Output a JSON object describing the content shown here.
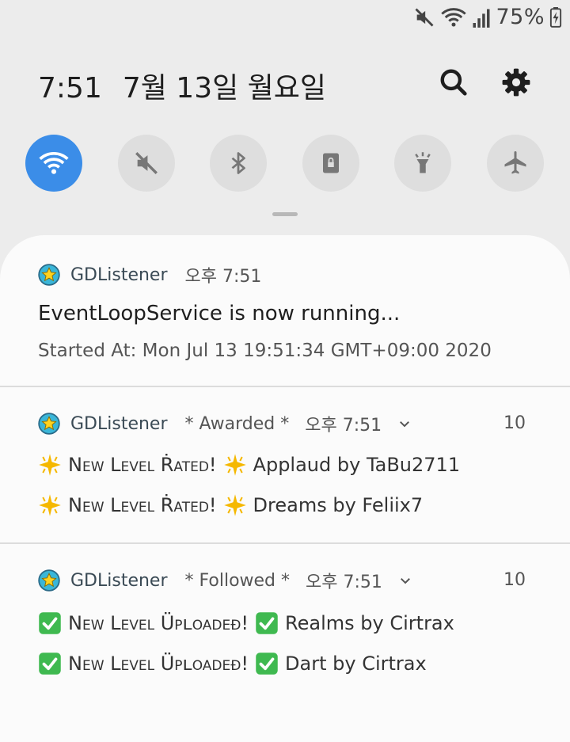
{
  "status": {
    "battery": "75%"
  },
  "header": {
    "time": "7:51",
    "date": "7월 13일 월요일"
  },
  "quick_settings": [
    {
      "name": "wifi",
      "on": true
    },
    {
      "name": "mute",
      "on": false
    },
    {
      "name": "bluetooth",
      "on": false
    },
    {
      "name": "portrait-lock",
      "on": false
    },
    {
      "name": "flashlight",
      "on": false
    },
    {
      "name": "airplane",
      "on": false
    }
  ],
  "notifications": [
    {
      "app": "GDListener",
      "time": "오후 7:51",
      "title": "EventLoopService is now running...",
      "text": "Started At: Mon Jul 13 19:51:34 GMT+09:00 2020"
    },
    {
      "app": "GDListener",
      "subtext": "* Awarded *",
      "time": "오후 7:51",
      "count": "10",
      "lines": [
        {
          "label": "New Level Ṙated!",
          "text": "Applaud by TaBu2711"
        },
        {
          "label": "New Level Ṙated!",
          "text": "Dreams by Feliix7"
        }
      ]
    },
    {
      "app": "GDListener",
      "subtext": "* Followed *",
      "time": "오후 7:51",
      "count": "10",
      "lines": [
        {
          "label": "New Level Üpʟoadeđ!",
          "text": "Realms by Cirtrax"
        },
        {
          "label": "New Level Üpʟoadeđ!",
          "text": "Dart by Cirtrax"
        }
      ]
    }
  ],
  "colors": {
    "accent": "#3b8de8",
    "check": "#3fb950",
    "sparkle": "#f5b800"
  }
}
